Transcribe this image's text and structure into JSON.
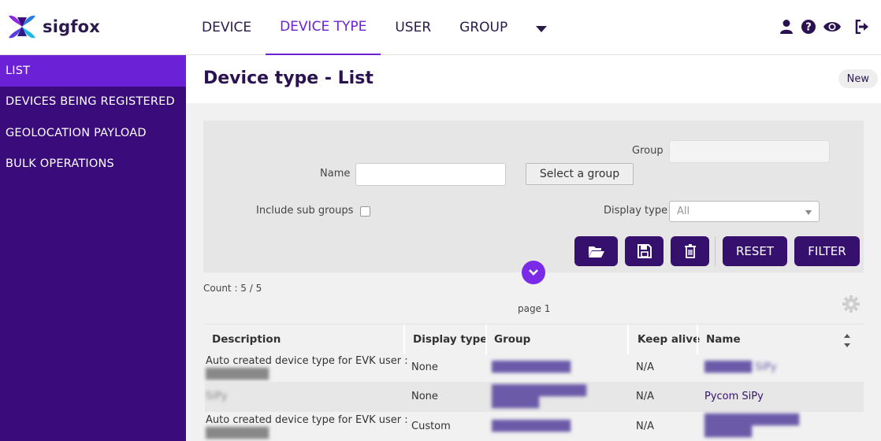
{
  "brand": {
    "name": "sigfox"
  },
  "nav": {
    "items": [
      "DEVICE",
      "DEVICE TYPE",
      "USER",
      "GROUP"
    ],
    "active": "DEVICE TYPE",
    "more_icon": "caret-down-icon"
  },
  "top_icons": [
    "user-icon",
    "help-icon",
    "eye-icon",
    "logout-icon"
  ],
  "sidebar": {
    "items": [
      {
        "label": "LIST",
        "active": true
      },
      {
        "label": "DEVICES BEING REGISTERED"
      },
      {
        "label": "GEOLOCATION PAYLOAD"
      },
      {
        "label": "BULK OPERATIONS"
      }
    ]
  },
  "page": {
    "title": "Device type - List",
    "new_label": "New"
  },
  "filter": {
    "group_label": "Group",
    "group_value": "",
    "name_label": "Name",
    "name_value": "",
    "select_group_label": "Select a group",
    "include_sub_groups_label": "Include sub groups",
    "include_sub_groups_checked": false,
    "display_type_label": "Display type",
    "display_type_value": "All",
    "icon_buttons": [
      "folder-open-icon",
      "save-icon",
      "trash-icon"
    ],
    "reset_label": "RESET",
    "filter_label": "FILTER",
    "expand_icon": "chevron-down-icon"
  },
  "results": {
    "count_text": "Count : 5 / 5",
    "page_text": "page 1",
    "settings_icon": "gear-icon"
  },
  "table": {
    "headers": [
      "Description",
      "Display type",
      "Group",
      "Keep alive",
      "Name"
    ],
    "rows": [
      {
        "description": "Auto created device type for EVK user :",
        "description_sub": "████████",
        "display_type": "None",
        "group": "██████████",
        "keep_alive": "N/A",
        "name": "██████ SiPy"
      },
      {
        "description": "SiPy",
        "display_type": "None",
        "group": "████████████ ██████",
        "keep_alive": "N/A",
        "name": "Pycom SiPy"
      },
      {
        "description": "Auto created device type for EVK user :",
        "description_sub": "████████",
        "display_type": "Custom",
        "group": "██████████",
        "keep_alive": "N/A",
        "name": "████████████ ██████"
      }
    ]
  },
  "colors": {
    "sidebar": "#3a0b7a",
    "accent": "#6b21d6",
    "button": "#35106d"
  }
}
